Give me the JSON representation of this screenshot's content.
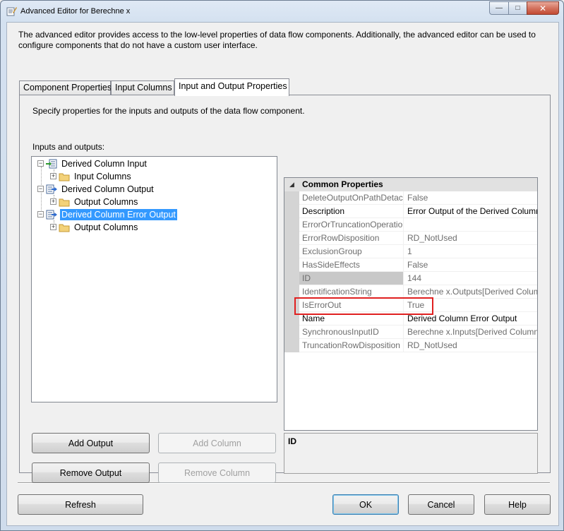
{
  "window": {
    "title": "Advanced Editor for Berechne x",
    "min_glyph": "—",
    "max_glyph": "□",
    "close_glyph": "✕"
  },
  "description": "The advanced editor provides access to the low-level properties of data flow components. Additionally, the advanced editor can be used to configure components that do not have a custom user interface.",
  "tabs": [
    {
      "label": "Component Properties",
      "active": false
    },
    {
      "label": "Input Columns",
      "active": false
    },
    {
      "label": "Input and Output Properties",
      "active": true
    }
  ],
  "panel": {
    "description": "Specify properties for the inputs and outputs of the data flow component.",
    "io_label": "Inputs and outputs:"
  },
  "tree": {
    "nodes": [
      {
        "label": "Derived Column Input",
        "expander": "−",
        "icon": "input-icon"
      },
      {
        "label": "Input Columns",
        "expander": "+",
        "icon": "folder-icon"
      },
      {
        "label": "Derived Column Output",
        "expander": "−",
        "icon": "output-icon"
      },
      {
        "label": "Output Columns",
        "expander": "+",
        "icon": "folder-icon"
      },
      {
        "label": "Derived Column Error Output",
        "expander": "−",
        "icon": "output-icon",
        "selected": true
      },
      {
        "label": "Output Columns",
        "expander": "+",
        "icon": "folder-icon"
      }
    ]
  },
  "property_grid": {
    "category": "Common Properties",
    "category_arrow": "◢",
    "rows": [
      {
        "name": "DeleteOutputOnPathDetached",
        "value": "False",
        "enabled": false
      },
      {
        "name": "Description",
        "value": "Error Output of the Derived Column",
        "enabled": true
      },
      {
        "name": "ErrorOrTruncationOperation",
        "value": "",
        "enabled": false
      },
      {
        "name": "ErrorRowDisposition",
        "value": "RD_NotUsed",
        "enabled": false
      },
      {
        "name": "ExclusionGroup",
        "value": "1",
        "enabled": false
      },
      {
        "name": "HasSideEffects",
        "value": "False",
        "enabled": false
      },
      {
        "name": "ID",
        "value": "144",
        "enabled": false,
        "highlighted": true
      },
      {
        "name": "IdentificationString",
        "value": "Berechne x.Outputs[Derived Column",
        "enabled": false
      },
      {
        "name": "IsErrorOut",
        "value": "True",
        "enabled": false
      },
      {
        "name": "Name",
        "value": "Derived Column Error Output",
        "enabled": true
      },
      {
        "name": "SynchronousInputID",
        "value": "Berechne x.Inputs[Derived Column",
        "enabled": false
      },
      {
        "name": "TruncationRowDisposition",
        "value": "RD_NotUsed",
        "enabled": false
      }
    ]
  },
  "help": {
    "title": "ID"
  },
  "buttons": {
    "add_output": "Add Output",
    "add_column": "Add Column",
    "remove_output": "Remove Output",
    "remove_column": "Remove Column",
    "refresh": "Refresh",
    "ok": "OK",
    "cancel": "Cancel",
    "help": "Help"
  },
  "colors": {
    "selection": "#3399ff",
    "annotation_border": "#e02020"
  }
}
